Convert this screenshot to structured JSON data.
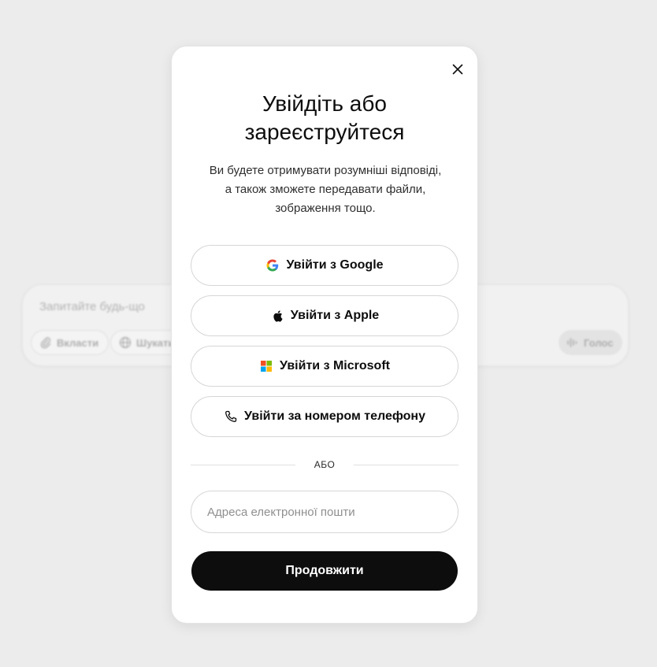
{
  "background": {
    "composer": {
      "placeholder": "Запитайте будь-що",
      "attach_label": "Вкласти",
      "search_label": "Шукати",
      "voice_label": "Голос"
    }
  },
  "modal": {
    "title": "Увійдіть або зареєструйтеся",
    "subtitle": "Ви будете отримувати розумніші відповіді, а також зможете передавати файли, зображення тощо.",
    "auth_buttons": {
      "google": "Увійти з Google",
      "apple": "Увійти з Apple",
      "microsoft": "Увійти з Microsoft",
      "phone": "Увійти за номером телефону"
    },
    "divider_text": "АБО",
    "email": {
      "placeholder": "Адреса електронної пошти",
      "value": ""
    },
    "continue_label": "Продовжити"
  },
  "icons": {
    "close": "close-icon",
    "google": "google-icon",
    "apple": "apple-icon",
    "microsoft": "microsoft-icon",
    "phone": "phone-icon",
    "attach": "paperclip-icon",
    "search": "globe-icon",
    "voice": "voice-wave-icon"
  },
  "colors": {
    "backdrop": "#ececec",
    "modal_bg": "#ffffff",
    "primary_button": "#0d0d0d",
    "primary_button_text": "#ffffff",
    "border": "#d6d6d6"
  }
}
